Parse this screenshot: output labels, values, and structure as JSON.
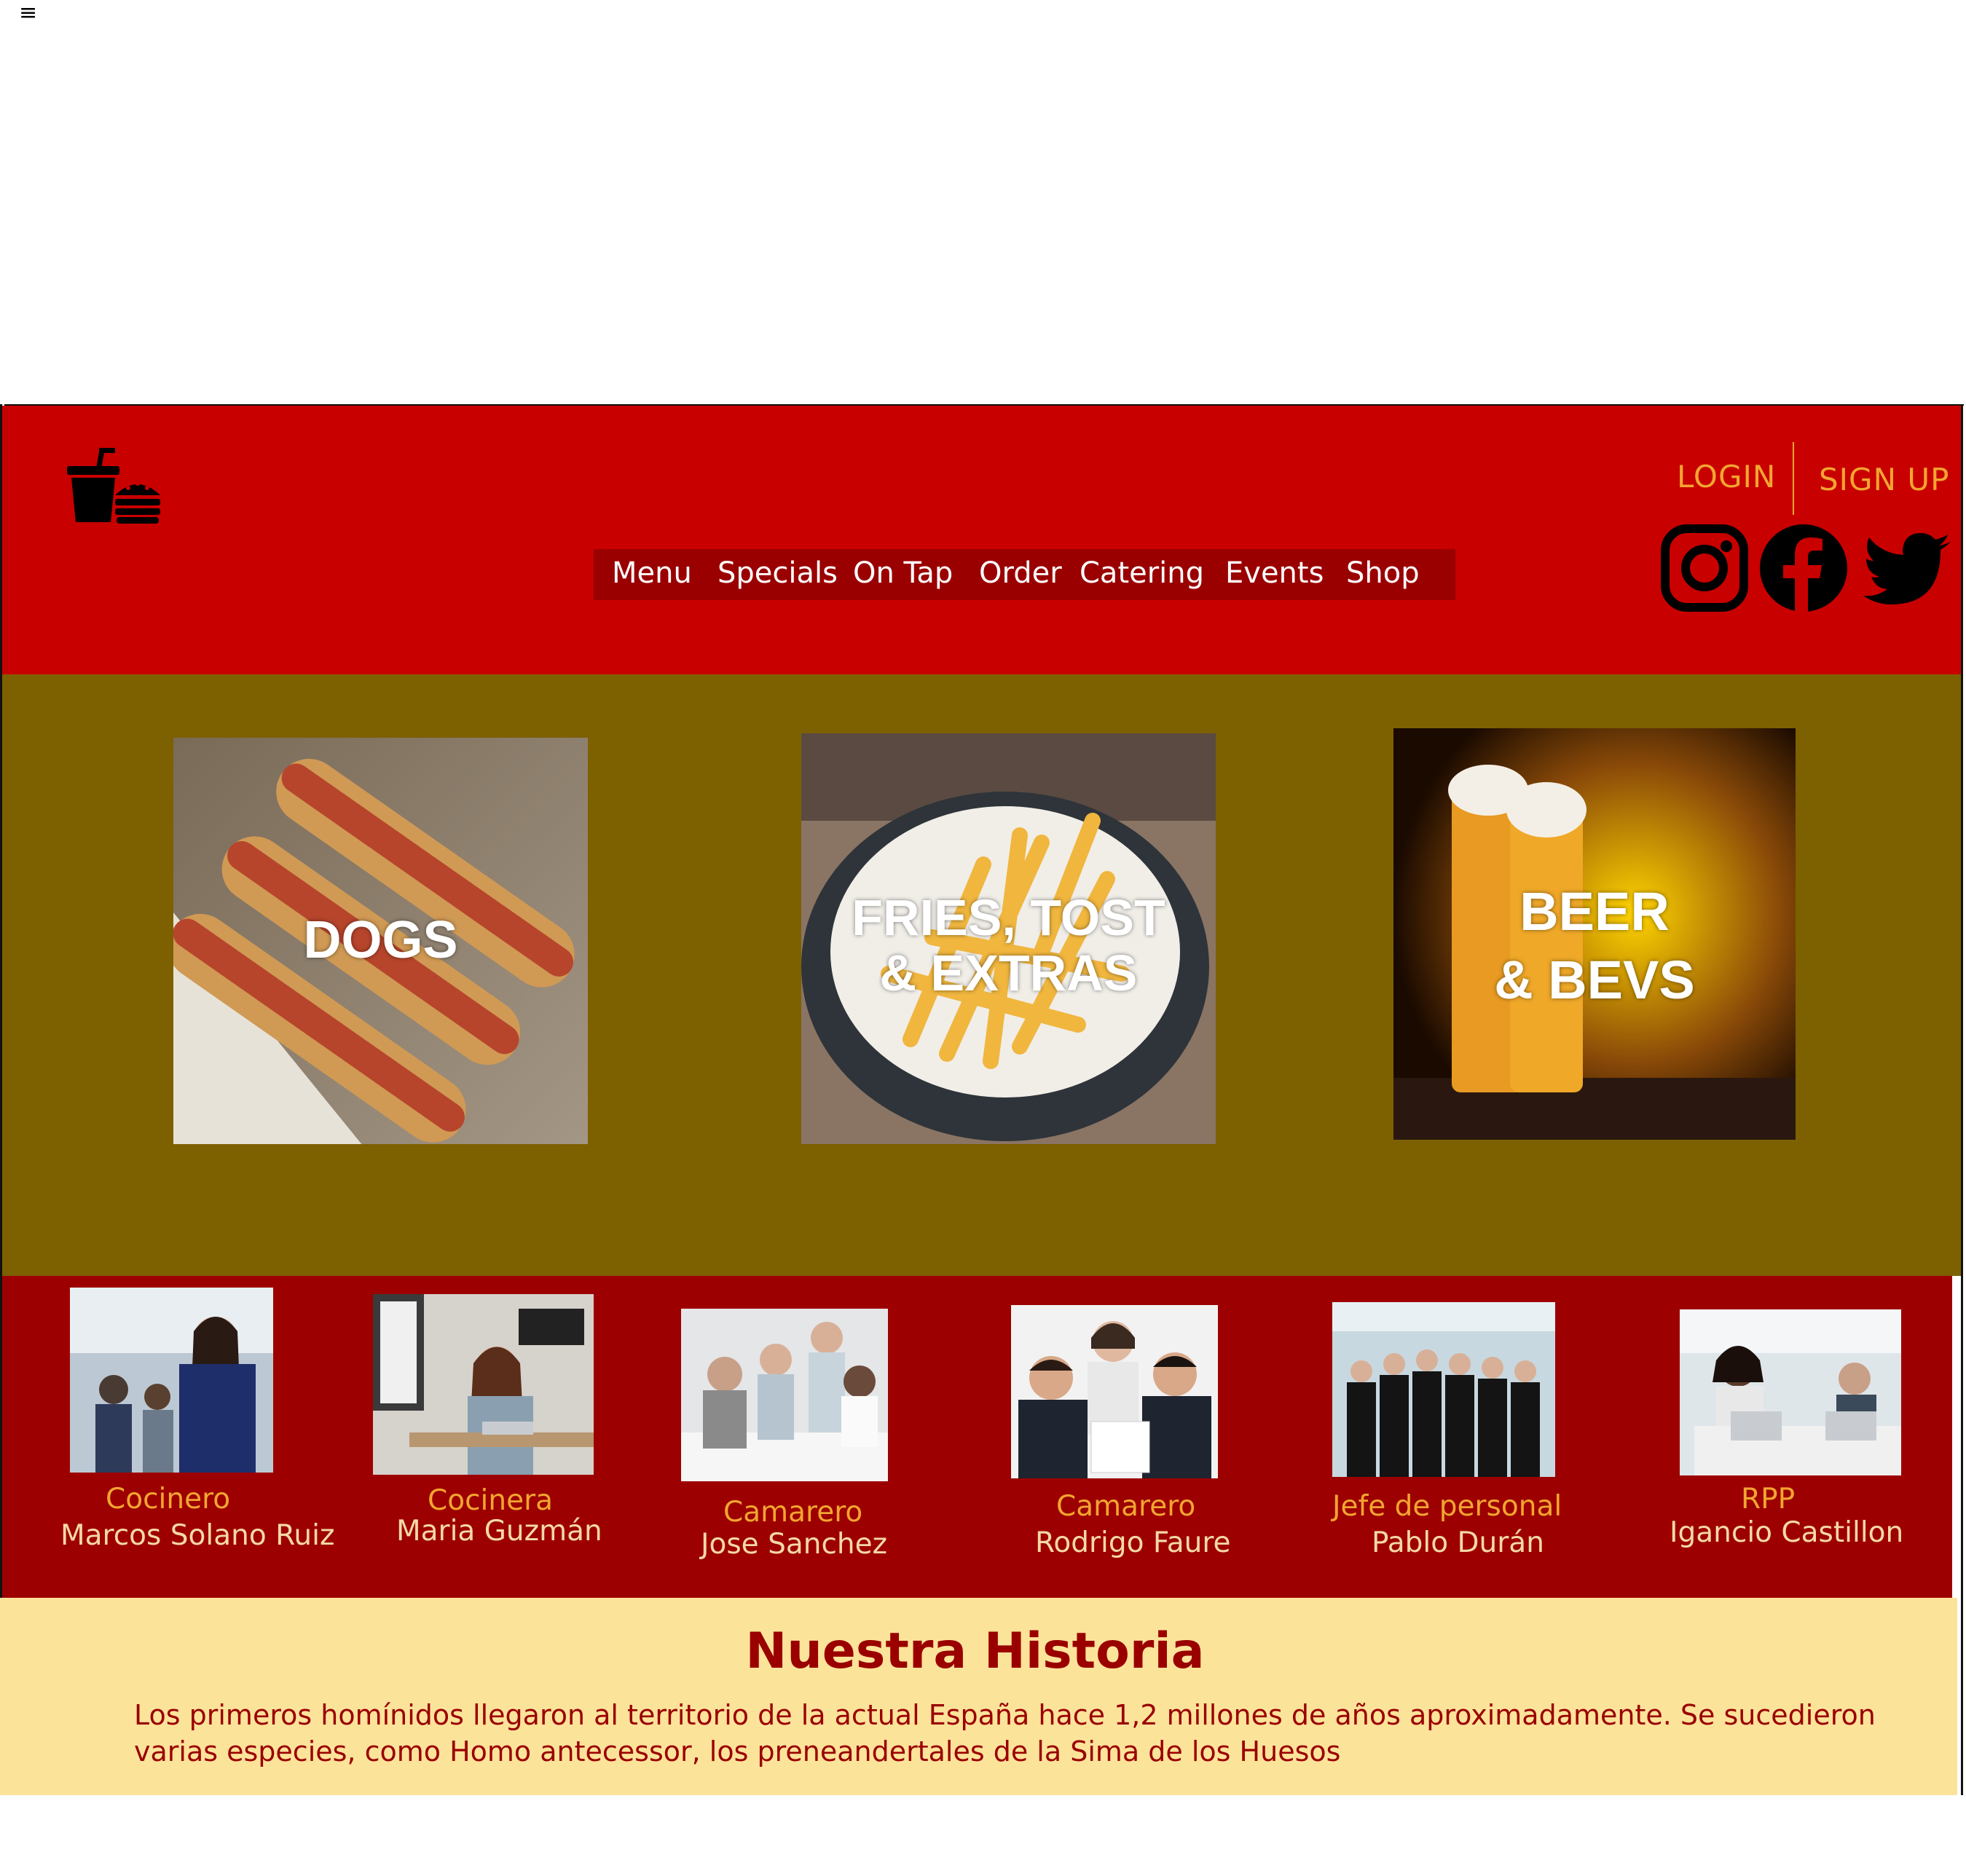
{
  "menu_toggle": "≡",
  "header": {
    "login": "LOGIN",
    "signup": "SIGN UP",
    "nav": [
      "Menu",
      "Specials",
      "On Tap",
      "Order",
      "Catering",
      "Events",
      "Shop"
    ],
    "social": [
      "instagram-icon",
      "facebook-icon",
      "twitter-icon"
    ]
  },
  "categories": [
    {
      "label": "DOGS"
    },
    {
      "label": "FRIES, TOST\n& EXTRAS"
    },
    {
      "label": "BEER\n& BEVS"
    }
  ],
  "staff": [
    {
      "role": "Cocinero",
      "name": "Marcos Solano Ruiz"
    },
    {
      "role": "Cocinera",
      "name": "Maria Guzmán"
    },
    {
      "role": "Camarero",
      "name": "Jose Sanchez"
    },
    {
      "role": "Camarero",
      "name": "Rodrigo Faure"
    },
    {
      "role": "Jefe de personal",
      "name": "Pablo Durán"
    },
    {
      "role": "RPP",
      "name": "Igancio Castillon"
    }
  ],
  "history": {
    "title": "Nuestra Historia",
    "text": "Los primeros homínidos llegaron al territorio de la actual España hace 1,2 millones de años aproximadamente. Se sucedieron varias especies, como Homo antecessor, los preneandertales de la Sima de los Huesos"
  },
  "colors": {
    "header_bg": "#c90000",
    "nav_bg": "#9a0000",
    "accent": "#f2a531",
    "categories_bg": "#7d6000",
    "staff_bg": "#9d0000",
    "history_bg": "#fce39a",
    "history_text": "#9a0000"
  }
}
